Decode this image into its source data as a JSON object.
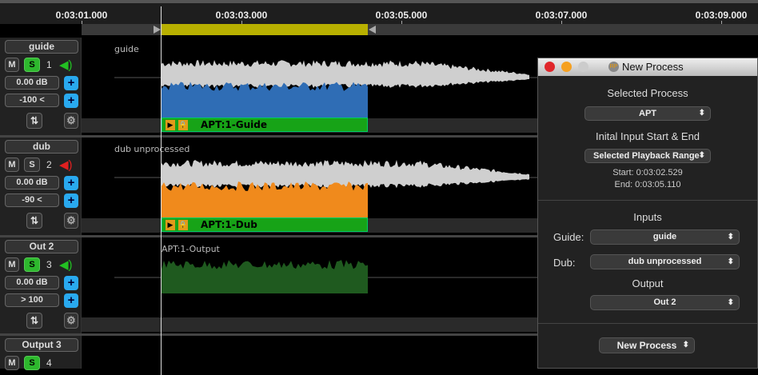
{
  "ruler": {
    "ticks": [
      "0:03:01.000",
      "0:03:03.000",
      "0:03:05.000",
      "0:03:07.000",
      "0:03:09.000"
    ]
  },
  "tracks": [
    {
      "name": "guide",
      "mute": "M",
      "solo": "S",
      "number": "1",
      "gain": "0.00 dB",
      "pan": "-100 <",
      "lane_label": "guide",
      "clip": "APT:1-Guide",
      "solo_on": true,
      "speaker_color": "#22c022"
    },
    {
      "name": "dub",
      "mute": "M",
      "solo": "S",
      "number": "2",
      "gain": "0.00 dB",
      "pan": "-90 <",
      "lane_label": "dub unprocessed",
      "clip": "APT:1-Dub",
      "solo_on": false,
      "speaker_color": "#e02020"
    },
    {
      "name": "Out 2",
      "mute": "M",
      "solo": "S",
      "number": "3",
      "gain": "0.00 dB",
      "pan": "> 100",
      "lane_label": "APT:1-Output",
      "solo_on": true,
      "speaker_color": "#22c022"
    },
    {
      "name": "Output 3",
      "mute": "M",
      "solo": "S",
      "number": "4"
    }
  ],
  "dialog": {
    "title": "New Process",
    "selected_process_label": "Selected Process",
    "process": "APT",
    "range_label": "Inital Input Start & End",
    "range": "Selected Playback Range",
    "start": "Start: 0:03:02.529",
    "end": "End: 0:03:05.110",
    "inputs_label": "Inputs",
    "guide_label": "Guide:",
    "guide_value": "guide",
    "dub_label": "Dub:",
    "dub_value": "dub unprocessed",
    "output_label": "Output",
    "output_value": "Out 2",
    "button": "New Process"
  },
  "colors": {
    "guide_fill": "#2f6db5",
    "dub_fill": "#f08a1c",
    "output_fill": "#1f5a1f",
    "selection": "#b8b000",
    "clip": "#17a317"
  }
}
